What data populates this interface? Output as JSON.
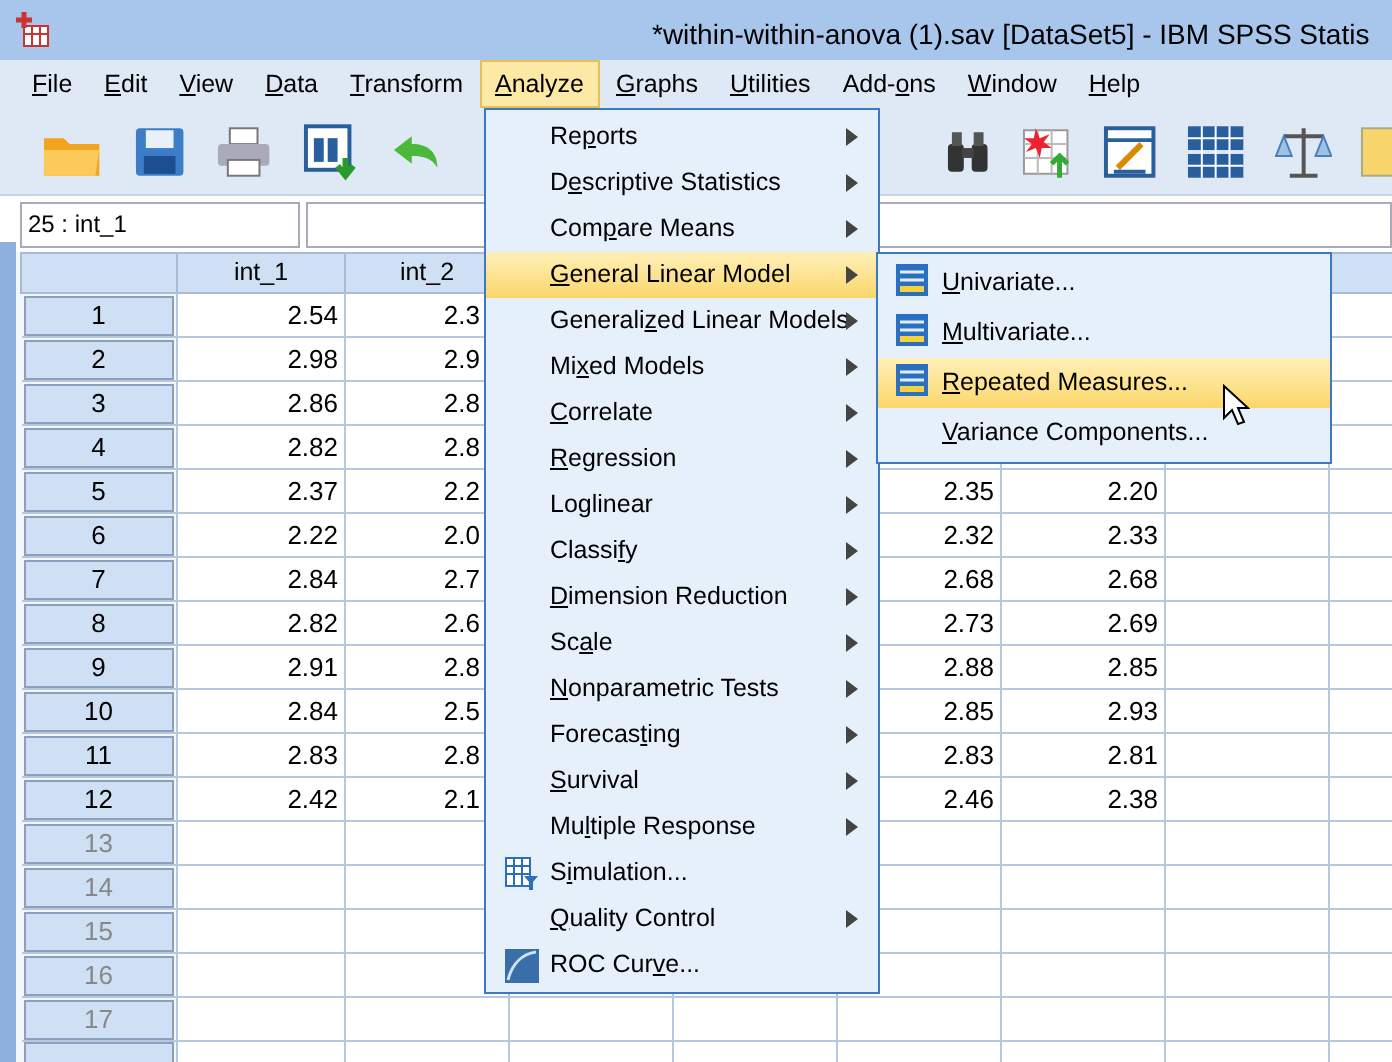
{
  "window": {
    "title": "*within-within-anova (1).sav [DataSet5] - IBM SPSS Statis"
  },
  "menu_bar": [
    {
      "label": {
        "key": "F",
        "after": "ile"
      },
      "selected": false
    },
    {
      "label": {
        "key": "E",
        "after": "dit"
      },
      "selected": false
    },
    {
      "label": {
        "key": "V",
        "after": "iew"
      },
      "selected": false
    },
    {
      "label": {
        "key": "D",
        "after": "ata"
      },
      "selected": false
    },
    {
      "label": {
        "key": "T",
        "after": "ransform"
      },
      "selected": false
    },
    {
      "label": {
        "key": "A",
        "after": "nalyze"
      },
      "selected": true
    },
    {
      "label": {
        "key": "G",
        "after": "raphs"
      },
      "selected": false
    },
    {
      "label": {
        "key": "U",
        "after": "tilities"
      },
      "selected": false
    },
    {
      "label": {
        "before": "Add-",
        "key": "o",
        "after": "ns"
      },
      "selected": false
    },
    {
      "label": {
        "key": "W",
        "after": "indow"
      },
      "selected": false
    },
    {
      "label": {
        "key": "H",
        "after": "elp"
      },
      "selected": false
    }
  ],
  "cell_reference": "25 : int_1",
  "table": {
    "columns": [
      "int_1",
      "int_2"
    ],
    "rows": [
      {
        "number": "1",
        "disabled": false,
        "int_1": "2.54",
        "int_2": "2.3"
      },
      {
        "number": "2",
        "disabled": false,
        "int_1": "2.98",
        "int_2": "2.9"
      },
      {
        "number": "3",
        "disabled": false,
        "int_1": "2.86",
        "int_2": "2.8"
      },
      {
        "number": "4",
        "disabled": false,
        "int_1": "2.82",
        "int_2": "2.8"
      },
      {
        "number": "5",
        "disabled": false,
        "int_1": "2.37",
        "int_2": "2.2",
        "column_5": "2.35",
        "column_6": "2.20"
      },
      {
        "number": "6",
        "disabled": false,
        "int_1": "2.22",
        "int_2": "2.0",
        "column_5": "2.32",
        "column_6": "2.33"
      },
      {
        "number": "7",
        "disabled": false,
        "int_1": "2.84",
        "int_2": "2.7",
        "column_5": "2.68",
        "column_6": "2.68"
      },
      {
        "number": "8",
        "disabled": false,
        "int_1": "2.82",
        "int_2": "2.6",
        "column_5": "2.73",
        "column_6": "2.69"
      },
      {
        "number": "9",
        "disabled": false,
        "int_1": "2.91",
        "int_2": "2.8",
        "column_5": "2.88",
        "column_6": "2.85"
      },
      {
        "number": "10",
        "disabled": false,
        "int_1": "2.84",
        "int_2": "2.5",
        "column_5": "2.85",
        "column_6": "2.93"
      },
      {
        "number": "11",
        "disabled": false,
        "int_1": "2.83",
        "int_2": "2.8",
        "column_5": "2.83",
        "column_6": "2.81"
      },
      {
        "number": "12",
        "disabled": false,
        "int_1": "2.42",
        "int_2": "2.1",
        "column_5": "2.46",
        "column_6": "2.38"
      },
      {
        "number": "13",
        "disabled": true
      },
      {
        "number": "14",
        "disabled": true
      },
      {
        "number": "15",
        "disabled": true
      },
      {
        "number": "16",
        "disabled": true
      },
      {
        "number": "17",
        "disabled": true
      }
    ]
  },
  "analyze_menu": [
    {
      "label": {
        "before": "Re",
        "key": "p",
        "after": "orts"
      },
      "submenu": true,
      "selected": false
    },
    {
      "label": {
        "before": "D",
        "key": "e",
        "after": "scriptive Statistics"
      },
      "submenu": true,
      "selected": false
    },
    {
      "label": {
        "before": "Com",
        "key": "p",
        "after": "are Means"
      },
      "submenu": true,
      "selected": false
    },
    {
      "label": {
        "key": "G",
        "after": "eneral Linear Model"
      },
      "submenu": true,
      "selected": true
    },
    {
      "label": {
        "before": "Generali",
        "key": "z",
        "after": "ed Linear Models"
      },
      "submenu": true,
      "selected": false
    },
    {
      "label": {
        "before": "Mi",
        "key": "x",
        "after": "ed Models"
      },
      "submenu": true,
      "selected": false
    },
    {
      "label": {
        "key": "C",
        "after": "orrelate"
      },
      "submenu": true,
      "selected": false
    },
    {
      "label": {
        "key": "R",
        "after": "egression"
      },
      "submenu": true,
      "selected": false
    },
    {
      "label": {
        "before": "Lo",
        "key": "g",
        "after": "linear"
      },
      "submenu": true,
      "selected": false
    },
    {
      "label": {
        "before": "Classi",
        "key": "f",
        "after": "y"
      },
      "submenu": true,
      "selected": false
    },
    {
      "label": {
        "key": "D",
        "after": "imension Reduction"
      },
      "submenu": true,
      "selected": false
    },
    {
      "label": {
        "before": "Sc",
        "key": "a",
        "after": "le"
      },
      "submenu": true,
      "selected": false
    },
    {
      "label": {
        "key": "N",
        "after": "onparametric Tests"
      },
      "submenu": true,
      "selected": false
    },
    {
      "label": {
        "before": "Forecas",
        "key": "t",
        "after": "ing"
      },
      "submenu": true,
      "selected": false
    },
    {
      "label": {
        "key": "S",
        "after": "urvival"
      },
      "submenu": true,
      "selected": false
    },
    {
      "label": {
        "before": "Mu",
        "key": "l",
        "after": "tiple Response"
      },
      "submenu": true,
      "selected": false
    },
    {
      "label": {
        "before": "S",
        "key": "i",
        "after": "mulation..."
      },
      "submenu": false,
      "selected": false,
      "kind": "simulation"
    },
    {
      "label": {
        "key": "Q",
        "after": "uality Control"
      },
      "submenu": true,
      "selected": false
    },
    {
      "label": {
        "before": "ROC Cur",
        "key": "v",
        "after": "e..."
      },
      "submenu": false,
      "selected": false,
      "kind": "roc"
    }
  ],
  "general_linear_model_submenu": [
    {
      "label": {
        "key": "U",
        "after": "nivariate..."
      },
      "selected": false,
      "kind": "glm"
    },
    {
      "label": {
        "key": "M",
        "after": "ultivariate..."
      },
      "selected": false,
      "kind": "glm"
    },
    {
      "label": {
        "key": "R",
        "after": "epeated Measures..."
      },
      "selected": true,
      "kind": "glm"
    },
    {
      "label": {
        "key": "V",
        "after": "ariance Components..."
      },
      "selected": false
    }
  ]
}
